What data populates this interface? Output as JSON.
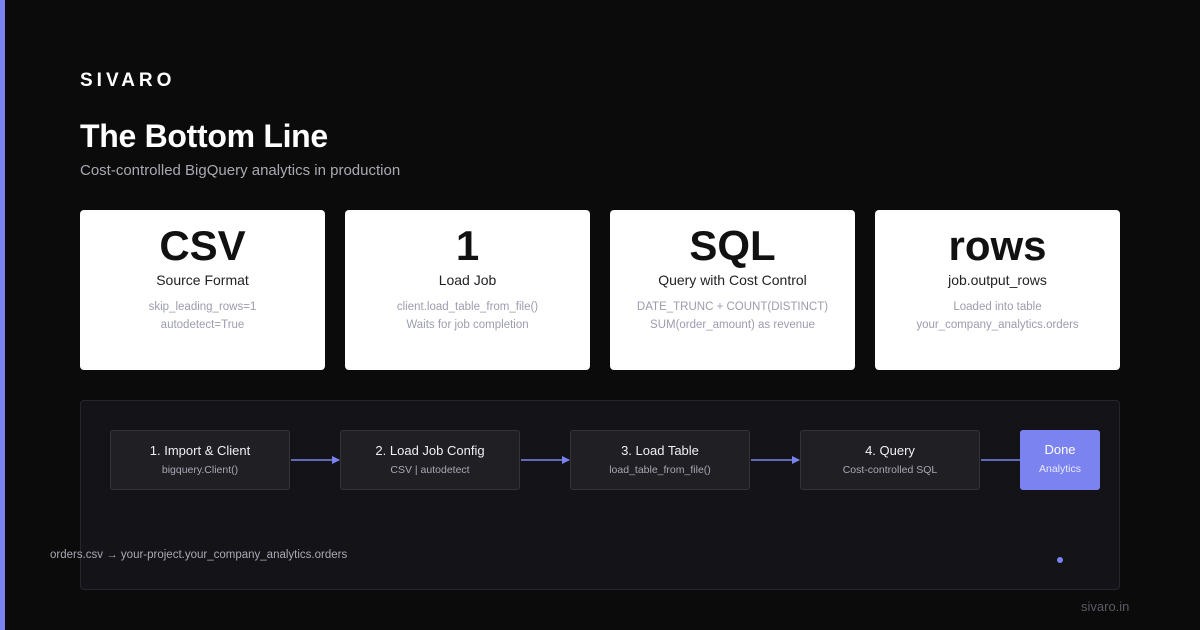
{
  "brand": "SIVARO",
  "title": "The Bottom Line",
  "subtitle": "Cost-controlled BigQuery analytics in production",
  "cards": [
    {
      "big": "CSV",
      "label": "Source Format",
      "details": [
        "skip_leading_rows=1",
        "autodetect=True"
      ]
    },
    {
      "big": "1",
      "label": "Load Job",
      "details": [
        "client.load_table_from_file()",
        "Waits for job completion"
      ]
    },
    {
      "big": "SQL",
      "label": "Query with Cost Control",
      "details": [
        "DATE_TRUNC + COUNT(DISTINCT)",
        "SUM(order_amount) as revenue"
      ]
    },
    {
      "big": "rows",
      "label": "job.output_rows",
      "details": [
        "Loaded into table",
        "your_company_analytics.orders"
      ]
    }
  ],
  "pipeline": {
    "steps": [
      {
        "title": "1. Import & Client",
        "sub": "bigquery.Client()"
      },
      {
        "title": "2. Load Job Config",
        "sub": "CSV | autodetect"
      },
      {
        "title": "3. Load Table",
        "sub": "load_table_from_file()"
      },
      {
        "title": "4. Query",
        "sub": "Cost-controlled SQL"
      }
    ],
    "done": {
      "title": "Done",
      "sub": "Analytics"
    },
    "path": "orders.csv → your-project.your_company_analytics.orders"
  },
  "footer": "sivaro.in",
  "colors": {
    "accent": "#7b83f0",
    "background": "#0b0b0b",
    "card": "#ffffff"
  }
}
